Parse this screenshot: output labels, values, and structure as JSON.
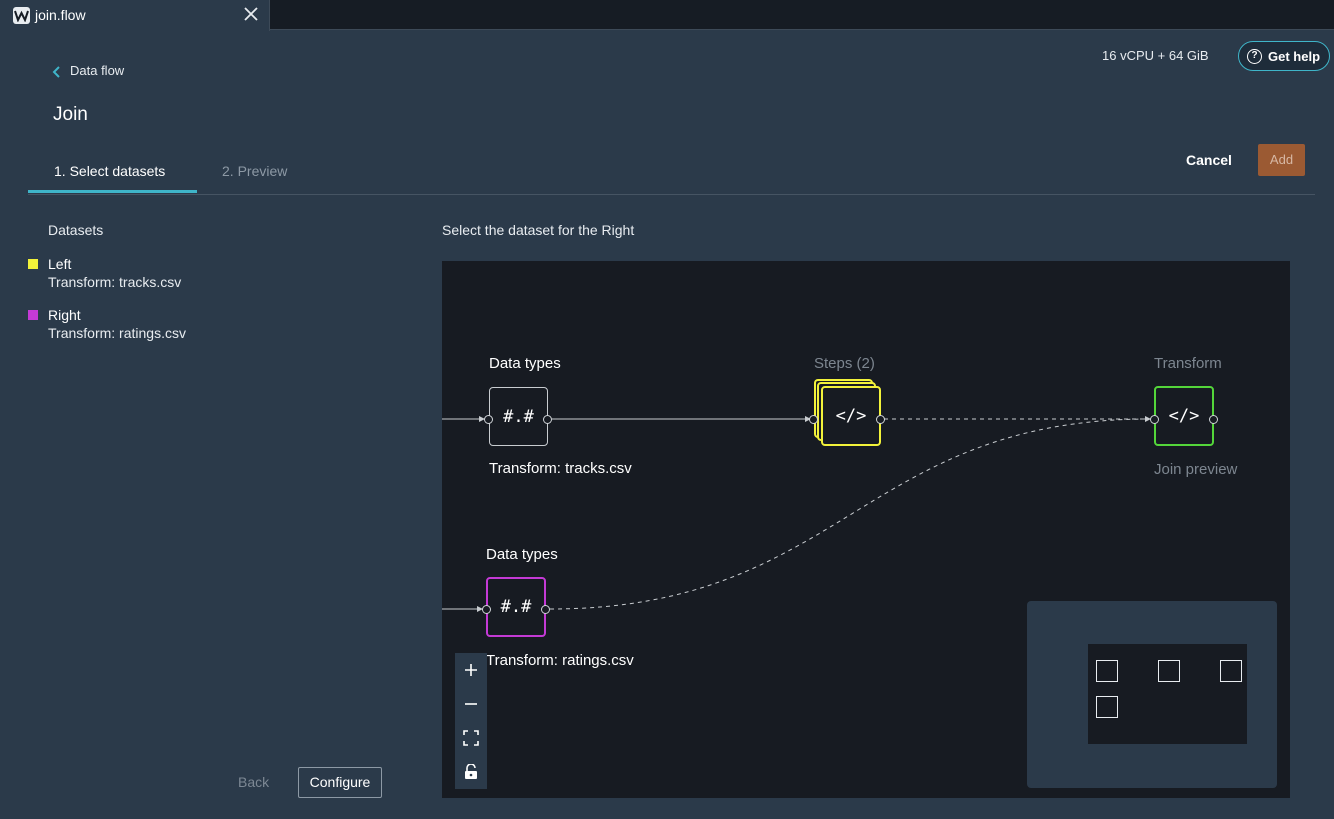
{
  "tabbar": {
    "file_name": "join.flow"
  },
  "header": {
    "resources": "16 vCPU + 64 GiB",
    "help_label": "Get help",
    "back_link": "Data flow",
    "title": "Join"
  },
  "steps": {
    "step1": "1. Select datasets",
    "step2": "2. Preview"
  },
  "actions": {
    "cancel": "Cancel",
    "add": "Add",
    "back": "Back",
    "configure": "Configure"
  },
  "datasets": {
    "title": "Datasets",
    "items": [
      {
        "name": "Left",
        "source": "Transform: tracks.csv",
        "color": "#f2f23a"
      },
      {
        "name": "Right",
        "source": "Transform: ratings.csv",
        "color": "#c43ad6"
      }
    ]
  },
  "canvas": {
    "caption": "Select the dataset for the Right",
    "nodes": {
      "left_types": {
        "label": "Data types",
        "glyph": "#.#",
        "sublabel": "Transform: tracks.csv",
        "color": "#c8ccd0"
      },
      "steps": {
        "label": "Steps (2)",
        "glyph": "</>",
        "color": "#f2f23a"
      },
      "transform": {
        "label": "Transform",
        "glyph": "</>",
        "sublabel": "Join preview",
        "color": "#54d63a"
      },
      "right_types": {
        "label": "Data types",
        "glyph": "#.#",
        "sublabel": "Transform: ratings.csv",
        "color": "#c43ad6"
      }
    },
    "zoom_controls": [
      "+",
      "–",
      "fit",
      "lock"
    ]
  }
}
